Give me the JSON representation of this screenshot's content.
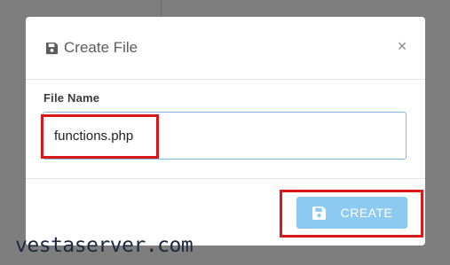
{
  "dialog": {
    "title": "Create File",
    "close_symbol": "×",
    "title_icon": "floppy-disk-icon",
    "close_icon": "close-icon"
  },
  "form": {
    "file_name_label": "File Name",
    "file_name_value": "functions.php"
  },
  "footer": {
    "create_label": "CREATE",
    "create_icon": "floppy-disk-icon"
  },
  "watermark": "vestaserver.com",
  "colors": {
    "overlay": "#7e7e7e",
    "button": "#8ccaf2",
    "highlight": "#d7191c",
    "input_border": "#7fb8e6"
  }
}
